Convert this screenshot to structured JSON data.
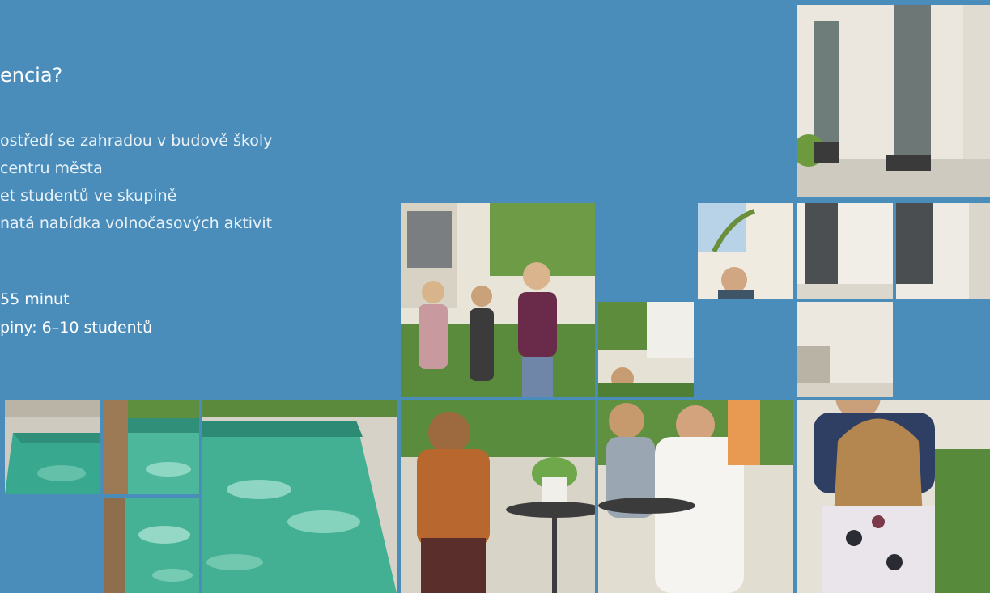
{
  "heading": "encia?",
  "features": [
    "ostředí se zahradou v budově školy",
    "centru města",
    "et studentů ve skupině",
    "natá nabídka volnočasových aktivit"
  ],
  "facts": [
    "55 minut",
    "piny: 6–10 studentů"
  ],
  "colors": {
    "background": "#4a8dbb",
    "text": "#ffffff",
    "pool_water": "#3fb59a",
    "foliage": "#4f8a3a",
    "building_wall": "#ece8e0"
  }
}
